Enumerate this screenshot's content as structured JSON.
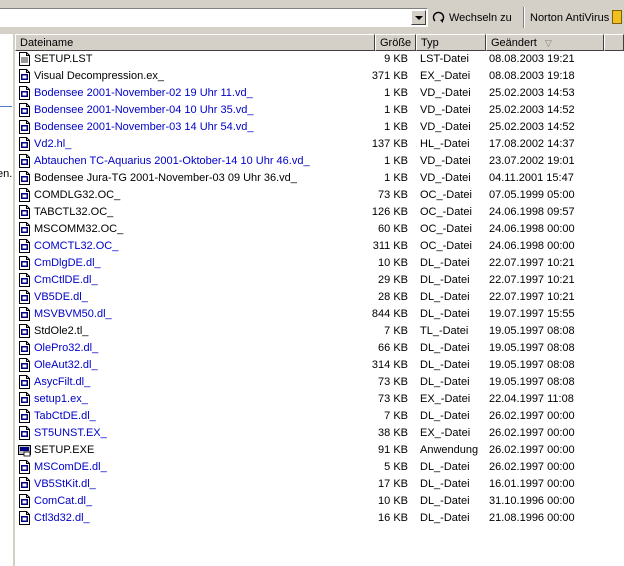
{
  "toolbar": {
    "address_value": "",
    "go_label": "Wechseln zu",
    "norton_label": "Norton AntiVirus"
  },
  "left_pane": {
    "fragment": "en."
  },
  "columns": {
    "name": "Dateiname",
    "size": "Größe",
    "type": "Typ",
    "modified": "Geändert"
  },
  "colors": {
    "compressed_text": "#0000c8",
    "normal_text": "#000000"
  },
  "files": [
    {
      "name": "SETUP.LST",
      "size": "9 KB",
      "type": "LST-Datei",
      "date": "08.08.2003 19:21",
      "icon": "text-file-icon",
      "color": "black"
    },
    {
      "name": "Visual Decompression.ex_",
      "size": "371 KB",
      "type": "EX_-Datei",
      "date": "08.08.2003 19:18",
      "icon": "generic-file-icon",
      "color": "black"
    },
    {
      "name": "Bodensee 2001-November-02 19 Uhr 11.vd_",
      "size": "1 KB",
      "type": "VD_-Datei",
      "date": "25.02.2003 14:53",
      "icon": "generic-file-icon",
      "color": "blue"
    },
    {
      "name": "Bodensee 2001-November-04 10 Uhr 35.vd_",
      "size": "1 KB",
      "type": "VD_-Datei",
      "date": "25.02.2003 14:52",
      "icon": "generic-file-icon",
      "color": "blue"
    },
    {
      "name": "Bodensee 2001-November-03 14 Uhr 54.vd_",
      "size": "1 KB",
      "type": "VD_-Datei",
      "date": "25.02.2003 14:52",
      "icon": "generic-file-icon",
      "color": "blue"
    },
    {
      "name": "Vd2.hl_",
      "size": "137 KB",
      "type": "HL_-Datei",
      "date": "17.08.2002 14:37",
      "icon": "generic-file-icon",
      "color": "blue"
    },
    {
      "name": "Abtauchen TC-Aquarius 2001-Oktober-14 10 Uhr 46.vd_",
      "size": "1 KB",
      "type": "VD_-Datei",
      "date": "23.07.2002 19:01",
      "icon": "generic-file-icon",
      "color": "blue"
    },
    {
      "name": "Bodensee Jura-TG 2001-November-03 09 Uhr 36.vd_",
      "size": "1 KB",
      "type": "VD_-Datei",
      "date": "04.11.2001 15:47",
      "icon": "generic-file-icon",
      "color": "black"
    },
    {
      "name": "COMDLG32.OC_",
      "size": "73 KB",
      "type": "OC_-Datei",
      "date": "07.05.1999 05:00",
      "icon": "generic-file-icon",
      "color": "black"
    },
    {
      "name": "TABCTL32.OC_",
      "size": "126 KB",
      "type": "OC_-Datei",
      "date": "24.06.1998 09:57",
      "icon": "generic-file-icon",
      "color": "black"
    },
    {
      "name": "MSCOMM32.OC_",
      "size": "60 KB",
      "type": "OC_-Datei",
      "date": "24.06.1998 00:00",
      "icon": "generic-file-icon",
      "color": "black"
    },
    {
      "name": "COMCTL32.OC_",
      "size": "311 KB",
      "type": "OC_-Datei",
      "date": "24.06.1998 00:00",
      "icon": "generic-file-icon",
      "color": "blue"
    },
    {
      "name": "CmDlgDE.dl_",
      "size": "10 KB",
      "type": "DL_-Datei",
      "date": "22.07.1997 10:21",
      "icon": "generic-file-icon",
      "color": "blue"
    },
    {
      "name": "CmCtlDE.dl_",
      "size": "29 KB",
      "type": "DL_-Datei",
      "date": "22.07.1997 10:21",
      "icon": "generic-file-icon",
      "color": "blue"
    },
    {
      "name": "VB5DE.dl_",
      "size": "28 KB",
      "type": "DL_-Datei",
      "date": "22.07.1997 10:21",
      "icon": "generic-file-icon",
      "color": "blue"
    },
    {
      "name": "MSVBVM50.dl_",
      "size": "844 KB",
      "type": "DL_-Datei",
      "date": "19.07.1997 15:55",
      "icon": "generic-file-icon",
      "color": "blue"
    },
    {
      "name": "StdOle2.tl_",
      "size": "7 KB",
      "type": "TL_-Datei",
      "date": "19.05.1997 08:08",
      "icon": "generic-file-icon",
      "color": "black"
    },
    {
      "name": "OlePro32.dl_",
      "size": "66 KB",
      "type": "DL_-Datei",
      "date": "19.05.1997 08:08",
      "icon": "generic-file-icon",
      "color": "blue"
    },
    {
      "name": "OleAut32.dl_",
      "size": "314 KB",
      "type": "DL_-Datei",
      "date": "19.05.1997 08:08",
      "icon": "generic-file-icon",
      "color": "blue"
    },
    {
      "name": "AsycFilt.dl_",
      "size": "73 KB",
      "type": "DL_-Datei",
      "date": "19.05.1997 08:08",
      "icon": "generic-file-icon",
      "color": "blue"
    },
    {
      "name": "setup1.ex_",
      "size": "73 KB",
      "type": "EX_-Datei",
      "date": "22.04.1997 11:08",
      "icon": "generic-file-icon",
      "color": "blue"
    },
    {
      "name": "TabCtDE.dl_",
      "size": "7 KB",
      "type": "DL_-Datei",
      "date": "26.02.1997 00:00",
      "icon": "generic-file-icon",
      "color": "blue"
    },
    {
      "name": "ST5UNST.EX_",
      "size": "38 KB",
      "type": "EX_-Datei",
      "date": "26.02.1997 00:00",
      "icon": "generic-file-icon",
      "color": "blue"
    },
    {
      "name": "SETUP.EXE",
      "size": "91 KB",
      "type": "Anwendung",
      "date": "26.02.1997 00:00",
      "icon": "setup-app-icon",
      "color": "black"
    },
    {
      "name": "MSComDE.dl_",
      "size": "5 KB",
      "type": "DL_-Datei",
      "date": "26.02.1997 00:00",
      "icon": "generic-file-icon",
      "color": "blue"
    },
    {
      "name": "VB5StKit.dl_",
      "size": "17 KB",
      "type": "DL_-Datei",
      "date": "16.01.1997 00:00",
      "icon": "generic-file-icon",
      "color": "blue"
    },
    {
      "name": "ComCat.dl_",
      "size": "10 KB",
      "type": "DL_-Datei",
      "date": "31.10.1996 00:00",
      "icon": "generic-file-icon",
      "color": "blue"
    },
    {
      "name": "Ctl3d32.dl_",
      "size": "16 KB",
      "type": "DL_-Datei",
      "date": "21.08.1996 00:00",
      "icon": "generic-file-icon",
      "color": "blue"
    }
  ]
}
